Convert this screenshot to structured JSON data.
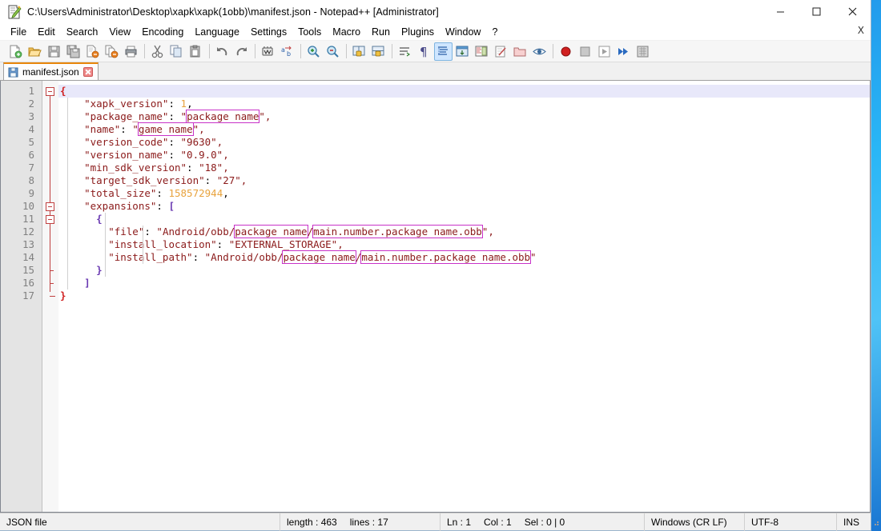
{
  "window": {
    "title": "C:\\Users\\Administrator\\Desktop\\xapk\\xapk(1obb)\\manifest.json - Notepad++ [Administrator]",
    "icon": "notepad-plus-plus-icon",
    "controls": {
      "minimize": "–",
      "maximize": "☐",
      "close": "✕"
    }
  },
  "menubar": {
    "items": [
      {
        "label": "File"
      },
      {
        "label": "Edit"
      },
      {
        "label": "Search"
      },
      {
        "label": "View"
      },
      {
        "label": "Encoding"
      },
      {
        "label": "Language"
      },
      {
        "label": "Settings"
      },
      {
        "label": "Tools"
      },
      {
        "label": "Macro"
      },
      {
        "label": "Run"
      },
      {
        "label": "Plugins"
      },
      {
        "label": "Window"
      },
      {
        "label": "?"
      }
    ],
    "document_close": "X"
  },
  "toolbar": {
    "buttons": [
      {
        "name": "new-file-icon",
        "title": "New"
      },
      {
        "name": "open-file-icon",
        "title": "Open"
      },
      {
        "name": "save-icon",
        "title": "Save"
      },
      {
        "name": "save-all-icon",
        "title": "Save All"
      },
      {
        "name": "close-file-icon",
        "title": "Close"
      },
      {
        "name": "close-all-icon",
        "title": "Close All"
      },
      {
        "name": "print-icon",
        "title": "Print"
      },
      {
        "name": "separator"
      },
      {
        "name": "cut-icon",
        "title": "Cut"
      },
      {
        "name": "copy-icon",
        "title": "Copy"
      },
      {
        "name": "paste-icon",
        "title": "Paste"
      },
      {
        "name": "separator"
      },
      {
        "name": "undo-icon",
        "title": "Undo"
      },
      {
        "name": "redo-icon",
        "title": "Redo"
      },
      {
        "name": "separator"
      },
      {
        "name": "find-icon",
        "title": "Find"
      },
      {
        "name": "replace-icon",
        "title": "Replace"
      },
      {
        "name": "separator"
      },
      {
        "name": "zoom-in-icon",
        "title": "Zoom In"
      },
      {
        "name": "zoom-out-icon",
        "title": "Zoom Out"
      },
      {
        "name": "separator"
      },
      {
        "name": "sync-vertical-scroll-icon",
        "title": "Synchronize Vertical Scrolling"
      },
      {
        "name": "sync-horizontal-scroll-icon",
        "title": "Synchronize Horizontal Scrolling"
      },
      {
        "name": "separator"
      },
      {
        "name": "word-wrap-icon",
        "title": "Word wrap"
      },
      {
        "name": "show-all-characters-icon",
        "title": "Show All Characters"
      },
      {
        "name": "indent-guide-icon",
        "title": "Show Indent Guide"
      },
      {
        "name": "ui-user-defined-dialog-icon",
        "title": "User-Defined Dialogue"
      },
      {
        "name": "document-map-icon",
        "title": "Document Map"
      },
      {
        "name": "function-list-icon",
        "title": "Function List"
      },
      {
        "name": "folder-as-workspace-icon",
        "title": "Folder as Workspace"
      },
      {
        "name": "monitoring-icon",
        "title": "Monitoring"
      },
      {
        "name": "separator"
      },
      {
        "name": "record-macro-icon",
        "title": "Start Recording"
      },
      {
        "name": "stop-recording-icon",
        "title": "Stop Recording"
      },
      {
        "name": "play-macro-icon",
        "title": "Playback"
      },
      {
        "name": "run-macro-multiple-icon",
        "title": "Run a Macro Multiple Times"
      },
      {
        "name": "save-macro-icon",
        "title": "Save Current Recorded Macro"
      }
    ]
  },
  "tabs": [
    {
      "label": "manifest.json",
      "icon": "saved-document-icon",
      "close": "close-tab-icon",
      "active": true
    }
  ],
  "editor": {
    "lines": [
      {
        "n": 1,
        "current": true,
        "fold": "open",
        "tokens": [
          {
            "t": "{",
            "c": "brace-r"
          }
        ],
        "indent": 0
      },
      {
        "n": 2,
        "current": false,
        "fold": null,
        "tokens": [
          {
            "t": "    \"xapk_version\"",
            "c": "key"
          },
          {
            "t": ": ",
            "c": "plain"
          },
          {
            "t": "1",
            "c": "num"
          },
          {
            "t": ",",
            "c": "plain"
          }
        ],
        "indent": 1
      },
      {
        "n": 3,
        "current": false,
        "fold": null,
        "tokens": [
          {
            "t": "    \"package_name\"",
            "c": "key"
          },
          {
            "t": ": ",
            "c": "plain"
          },
          {
            "t": "\"",
            "c": "str"
          },
          {
            "t": "package name",
            "c": "str",
            "hl": true
          },
          {
            "t": "\",",
            "c": "str"
          }
        ],
        "indent": 1
      },
      {
        "n": 4,
        "current": false,
        "fold": null,
        "tokens": [
          {
            "t": "    \"name\"",
            "c": "key"
          },
          {
            "t": ": ",
            "c": "plain"
          },
          {
            "t": "\"",
            "c": "str"
          },
          {
            "t": "game name",
            "c": "str",
            "hl": true
          },
          {
            "t": "\",",
            "c": "str"
          }
        ],
        "indent": 1
      },
      {
        "n": 5,
        "current": false,
        "fold": null,
        "tokens": [
          {
            "t": "    \"version_code\"",
            "c": "key"
          },
          {
            "t": ": ",
            "c": "plain"
          },
          {
            "t": "\"9630\",",
            "c": "str"
          }
        ],
        "indent": 1
      },
      {
        "n": 6,
        "current": false,
        "fold": null,
        "tokens": [
          {
            "t": "    \"version_name\"",
            "c": "key"
          },
          {
            "t": ": ",
            "c": "plain"
          },
          {
            "t": "\"0.9.0\",",
            "c": "str"
          }
        ],
        "indent": 1
      },
      {
        "n": 7,
        "current": false,
        "fold": null,
        "tokens": [
          {
            "t": "    \"min_sdk_version\"",
            "c": "key"
          },
          {
            "t": ": ",
            "c": "plain"
          },
          {
            "t": "\"18\",",
            "c": "str"
          }
        ],
        "indent": 1
      },
      {
        "n": 8,
        "current": false,
        "fold": null,
        "tokens": [
          {
            "t": "    \"target_sdk_version\"",
            "c": "key"
          },
          {
            "t": ": ",
            "c": "plain"
          },
          {
            "t": "\"27\",",
            "c": "str"
          }
        ],
        "indent": 1
      },
      {
        "n": 9,
        "current": false,
        "fold": null,
        "tokens": [
          {
            "t": "    \"total_size\"",
            "c": "key"
          },
          {
            "t": ": ",
            "c": "plain"
          },
          {
            "t": "158572944",
            "c": "num"
          },
          {
            "t": ",",
            "c": "plain"
          }
        ],
        "indent": 1
      },
      {
        "n": 10,
        "current": false,
        "fold": "open",
        "tokens": [
          {
            "t": "    \"expansions\"",
            "c": "key"
          },
          {
            "t": ": ",
            "c": "plain"
          },
          {
            "t": "[",
            "c": "brace-p"
          }
        ],
        "indent": 1
      },
      {
        "n": 11,
        "current": false,
        "fold": "open",
        "tokens": [
          {
            "t": "      ",
            "c": "plain"
          },
          {
            "t": "{",
            "c": "brace-p"
          }
        ],
        "indent": 2
      },
      {
        "n": 12,
        "current": false,
        "fold": null,
        "tokens": [
          {
            "t": "        \"file\"",
            "c": "key"
          },
          {
            "t": ": ",
            "c": "plain"
          },
          {
            "t": "\"Android/obb/",
            "c": "str"
          },
          {
            "t": "package name",
            "c": "str",
            "hl": true
          },
          {
            "t": "/",
            "c": "str"
          },
          {
            "t": "main.number.package name.obb",
            "c": "str",
            "hl": true
          },
          {
            "t": "\",",
            "c": "str"
          }
        ],
        "indent": 3
      },
      {
        "n": 13,
        "current": false,
        "fold": null,
        "tokens": [
          {
            "t": "        \"install_location\"",
            "c": "key"
          },
          {
            "t": ": ",
            "c": "plain"
          },
          {
            "t": "\"EXTERNAL_STORAGE\",",
            "c": "str"
          }
        ],
        "indent": 3
      },
      {
        "n": 14,
        "current": false,
        "fold": null,
        "tokens": [
          {
            "t": "        \"install_path\"",
            "c": "key"
          },
          {
            "t": ": ",
            "c": "plain"
          },
          {
            "t": "\"Android/obb/",
            "c": "str"
          },
          {
            "t": "package name",
            "c": "str",
            "hl": true
          },
          {
            "t": "/",
            "c": "str"
          },
          {
            "t": "main.number.package name.obb",
            "c": "str",
            "hl": true
          },
          {
            "t": "\"",
            "c": "str"
          }
        ],
        "indent": 3
      },
      {
        "n": 15,
        "current": false,
        "fold": "end",
        "tokens": [
          {
            "t": "      ",
            "c": "plain"
          },
          {
            "t": "}",
            "c": "brace-p"
          }
        ],
        "indent": 2
      },
      {
        "n": 16,
        "current": false,
        "fold": "end",
        "tokens": [
          {
            "t": "    ",
            "c": "plain"
          },
          {
            "t": "]",
            "c": "brace-p"
          }
        ],
        "indent": 1
      },
      {
        "n": 17,
        "current": false,
        "fold": "tail",
        "tokens": [
          {
            "t": "}",
            "c": "brace-r"
          }
        ],
        "indent": 0
      }
    ]
  },
  "statusbar": {
    "file_type": "JSON file",
    "length_label": "length : 463",
    "lines_label": "lines : 17",
    "ln": "Ln : 1",
    "col": "Col : 1",
    "sel": "Sel : 0 | 0",
    "eol": "Windows (CR LF)",
    "encoding": "UTF-8",
    "insert_mode": "INS"
  },
  "colors": {
    "accent_tab": "#e8860a",
    "highlight_box": "#c832c8",
    "key_string": "#8b1a1a",
    "number": "#e8a33d",
    "brace_match": "#d02020",
    "brace_punct": "#6a3ab2",
    "current_line": "#e8e8fa",
    "gutter": "#e4e4e4"
  }
}
